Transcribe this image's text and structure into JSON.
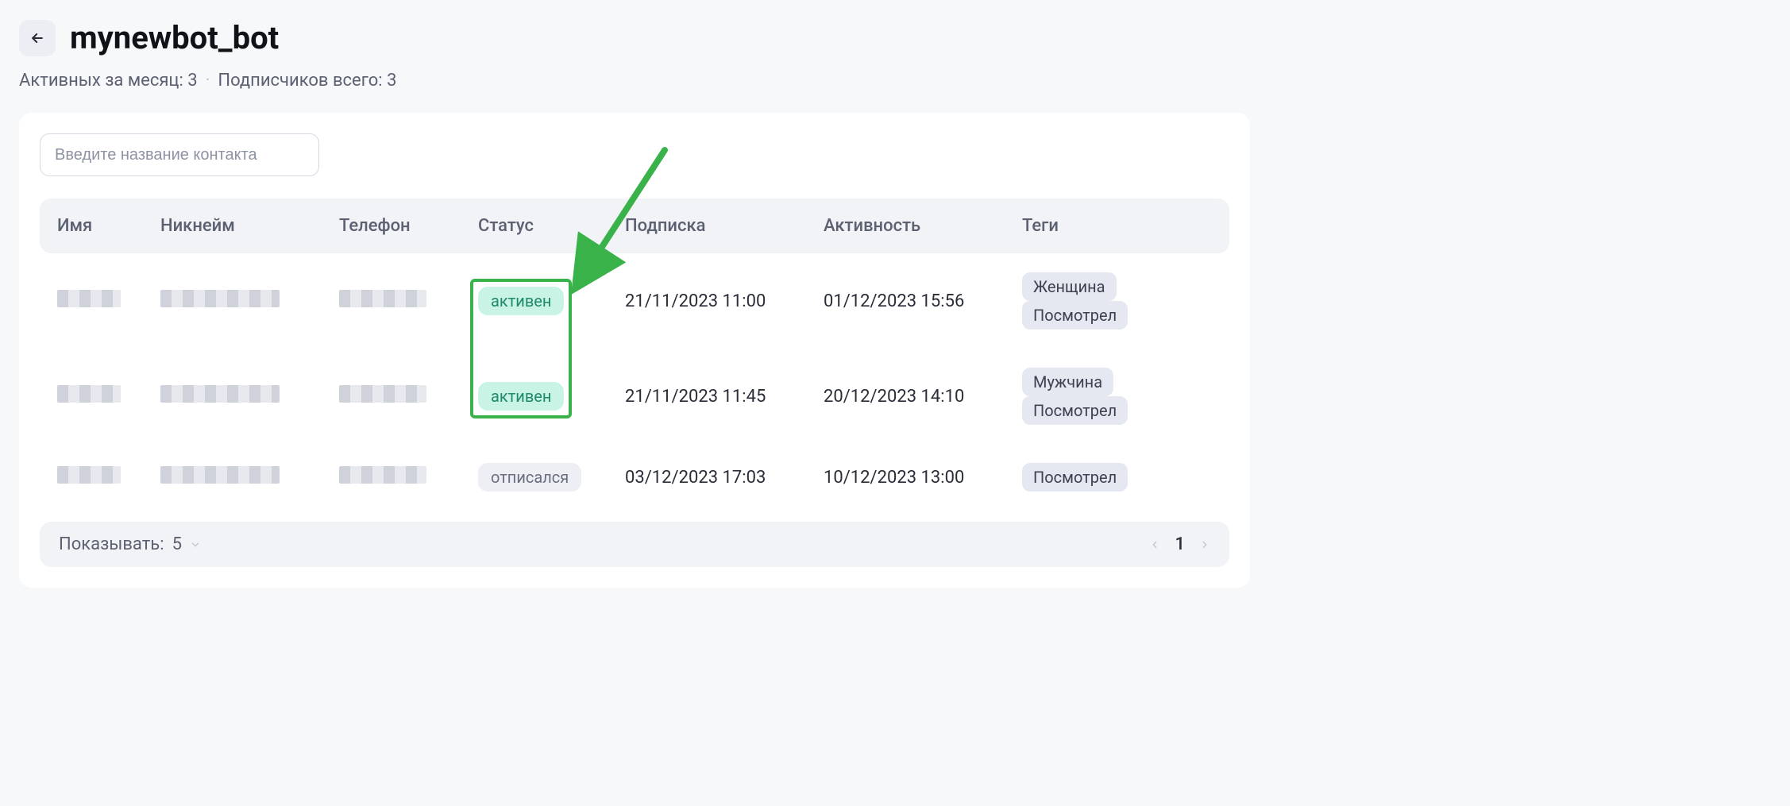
{
  "header": {
    "title": "mynewbot_bot"
  },
  "stats": {
    "active_month_label": "Активных за месяц:",
    "active_month_value": "3",
    "total_subs_label": "Подписчиков всего:",
    "total_subs_value": "3"
  },
  "search": {
    "placeholder": "Введите название контакта"
  },
  "columns": {
    "name": "Имя",
    "nickname": "Никнейм",
    "phone": "Телефон",
    "status": "Статус",
    "subscription": "Подписка",
    "activity": "Активность",
    "tags": "Теги"
  },
  "status_labels": {
    "active": "активен",
    "unsubscribed": "отписался"
  },
  "rows": [
    {
      "status": "active",
      "subscription": "21/11/2023 11:00",
      "activity": "01/12/2023 15:56",
      "tags": [
        "Женщина",
        "Посмотрел"
      ]
    },
    {
      "status": "active",
      "subscription": "21/11/2023 11:45",
      "activity": "20/12/2023 14:10",
      "tags": [
        "Мужчина",
        "Посмотрел"
      ]
    },
    {
      "status": "unsubscribed",
      "subscription": "03/12/2023 17:03",
      "activity": "10/12/2023 13:00",
      "tags": [
        "Посмотрел"
      ]
    }
  ],
  "footer": {
    "page_size_label": "Показывать:",
    "page_size_value": "5",
    "current_page": "1"
  },
  "annotation": {
    "arrow_color": "#39b24a"
  }
}
